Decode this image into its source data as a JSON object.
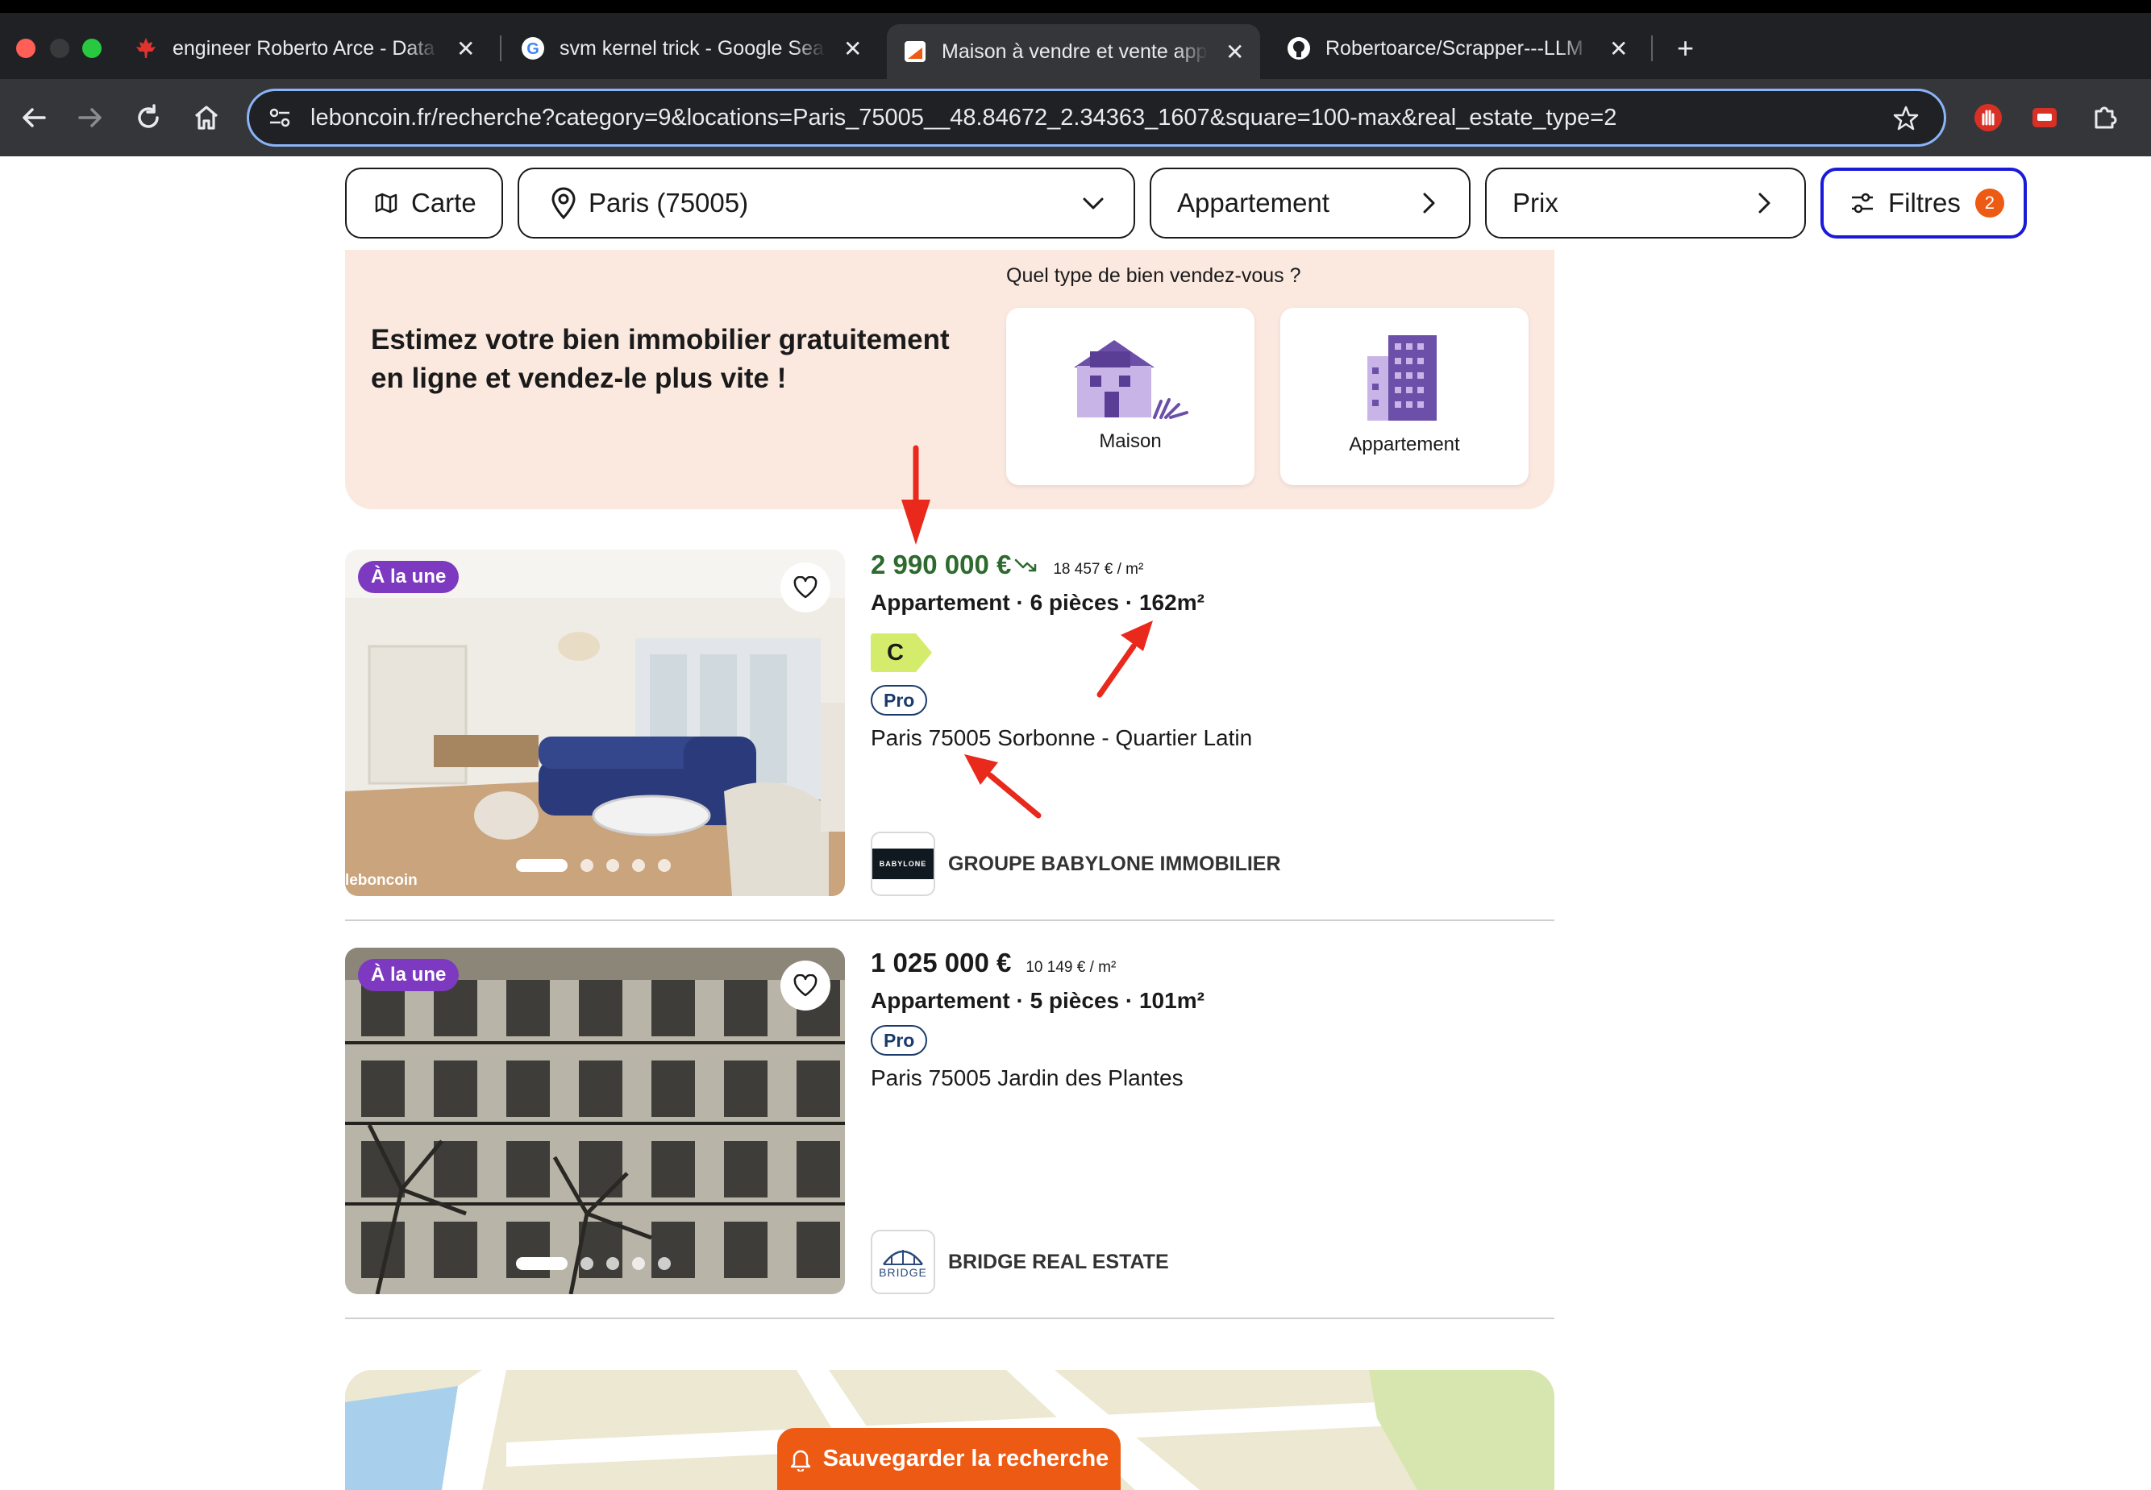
{
  "browser": {
    "tabs": [
      {
        "title": "engineer Roberto Arce - Data",
        "icon": "maple-leaf-icon"
      },
      {
        "title": "svm kernel trick - Google Sea",
        "icon": "google-icon"
      },
      {
        "title": "Maison à vendre et vente app",
        "icon": "leboncoin-icon"
      },
      {
        "title": "Robertoarce/Scrapper---LLM",
        "icon": "github-icon"
      }
    ],
    "new_tab": "+",
    "url": "leboncoin.fr/recherche?category=9&locations=Paris_75005__48.84672_2.34363_1607&square=100-max&real_estate_type=2"
  },
  "filters": {
    "map_label": "Carte",
    "location": "Paris (75005)",
    "type": "Appartement",
    "price": "Prix",
    "filters_label": "Filtres",
    "filters_count": "2"
  },
  "promo": {
    "title": "Estimez votre bien immobilier gratuitement en ligne et vendez-le plus vite !",
    "question": "Quel type de bien vendez-vous ?",
    "options": [
      "Maison",
      "Appartement"
    ]
  },
  "listings": [
    {
      "badge": "À la une",
      "price": "2 990 000 €",
      "price_per_m2": "18 457 € / m²",
      "price_color": "#2d6a2d",
      "title": "Appartement · 6 pièces · 162m²",
      "energy_class": "C",
      "seller_type": "Pro",
      "location": "Paris 75005 Sorbonne - Quartier Latin",
      "agency": "GROUPE BABYLONE IMMOBILIER",
      "agency_logo_text": "BABYLONE",
      "watermark": "leboncoin"
    },
    {
      "badge": "À la une",
      "price": "1 025 000 €",
      "price_per_m2": "10 149 € / m²",
      "price_color": "#1a1a1a",
      "title": "Appartement · 5 pièces · 101m²",
      "seller_type": "Pro",
      "location": "Paris 75005 Jardin des Plantes",
      "agency": "BRIDGE REAL ESTATE",
      "agency_logo_text": "BRIDGE"
    }
  ],
  "save_search": "Sauvegarder la recherche",
  "colors": {
    "accent": "#ec5a13",
    "badge_purple": "#7d3ac1",
    "annotation_arrow": "#e8291c",
    "focus_blue": "#1a1ad9"
  }
}
